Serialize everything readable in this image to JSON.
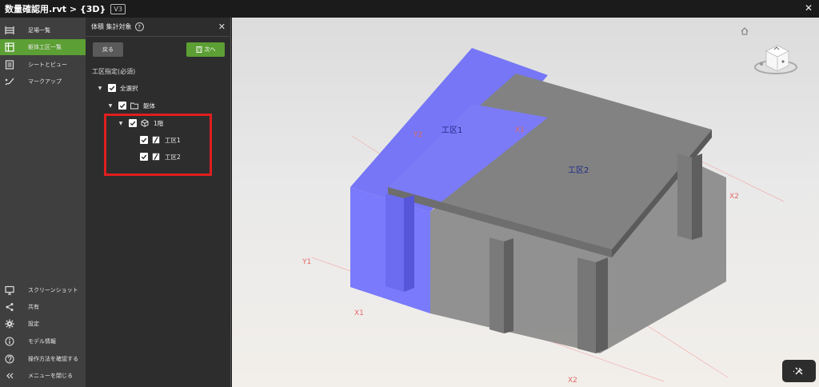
{
  "window": {
    "title": "数量確認用.rvt > {3D}",
    "version": "V3",
    "close_glyph": "✕"
  },
  "nav": {
    "top_items": [
      {
        "label": "足場一覧",
        "icon": "scaffold-icon",
        "active": false
      },
      {
        "label": "躯体工区一覧",
        "icon": "grid-icon",
        "active": true
      },
      {
        "label": "シートとビュー",
        "icon": "sheets-icon",
        "active": false
      },
      {
        "label": "マークアップ",
        "icon": "markup-icon",
        "active": false
      }
    ],
    "bottom_items": [
      {
        "label": "スクリーンショット",
        "icon": "monitor-icon"
      },
      {
        "label": "共有",
        "icon": "share-icon"
      },
      {
        "label": "設定",
        "icon": "gear-icon"
      },
      {
        "label": "モデル情報",
        "icon": "info-icon"
      },
      {
        "label": "操作方法を確認する",
        "icon": "help-icon"
      },
      {
        "label": "メニューを閉じる",
        "icon": "collapse-icon"
      }
    ]
  },
  "panel": {
    "title": "体積 集計対象",
    "help_glyph": "?",
    "close_glyph": "✕",
    "back_label": "戻る",
    "next_label": "次へ",
    "section_title": "工区指定(必須)",
    "tree": [
      {
        "label": "全選択",
        "checked": true,
        "icon": null
      },
      {
        "label": "躯体",
        "checked": true,
        "icon": "folder-icon"
      },
      {
        "label": "1階",
        "checked": true,
        "icon": "cube-icon"
      },
      {
        "label": "工区1",
        "checked": true,
        "icon": "slash-icon"
      },
      {
        "label": "工区2",
        "checked": true,
        "icon": "slash-icon"
      }
    ]
  },
  "viewport": {
    "grid_labels": {
      "y2": "Y2",
      "x1_top": "X1",
      "x2_right": "X2",
      "y1": "Y1",
      "x1_bottom": "X1",
      "x2_bottom": "X2"
    },
    "zones": {
      "zone1": "工区1",
      "zone2": "工区2"
    },
    "colors": {
      "zone1": "#7a7afc",
      "zone2": "#7b7b7b",
      "accent": "#5c9f34",
      "highlight": "#e01e1e"
    }
  }
}
